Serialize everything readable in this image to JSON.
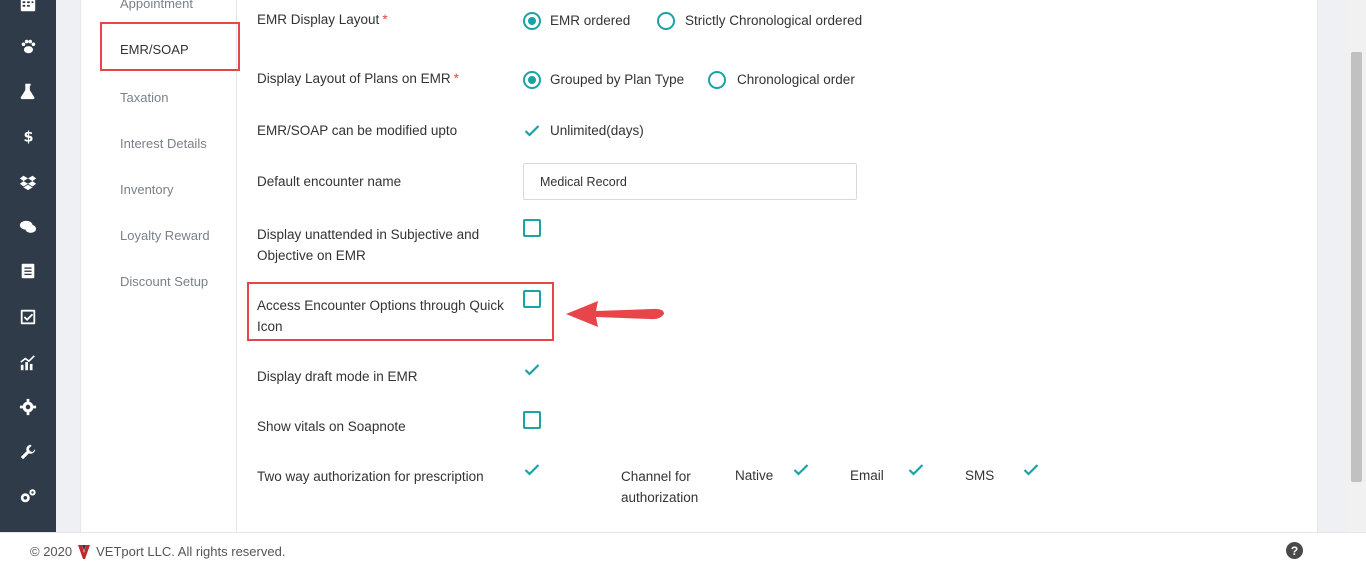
{
  "sidebar_icons": [
    "calendar-icon",
    "paw-icon",
    "flask-icon",
    "dollar-icon",
    "dropbox-icon",
    "chat-icon",
    "ledger-icon",
    "checklist-icon",
    "analytics-icon",
    "gear-icon",
    "wrench-icon",
    "cogs-icon"
  ],
  "subnav": {
    "items": [
      {
        "label": "Appointment"
      },
      {
        "label": "EMR/SOAP"
      },
      {
        "label": "Taxation"
      },
      {
        "label": "Interest Details"
      },
      {
        "label": "Inventory"
      },
      {
        "label": "Loyalty Reward"
      },
      {
        "label": "Discount Setup"
      }
    ],
    "active": "EMR/SOAP"
  },
  "settings": {
    "emr_display_layout": {
      "label": "EMR Display Layout",
      "required_mark": "*",
      "options": [
        {
          "label": "EMR ordered",
          "selected": true
        },
        {
          "label": "Strictly Chronological ordered",
          "selected": false
        }
      ]
    },
    "plans_layout": {
      "label": "Display Layout of Plans on EMR",
      "required_mark": "*",
      "options": [
        {
          "label": "Grouped by Plan Type",
          "selected": true
        },
        {
          "label": "Chronological order",
          "selected": false
        }
      ]
    },
    "modify_upto": {
      "label": "EMR/SOAP can be modified upto",
      "checked": true,
      "value_label": "Unlimited(days)"
    },
    "default_encounter": {
      "label": "Default encounter name",
      "value": "Medical Record"
    },
    "display_unattended": {
      "label_line1": "Display unattended in Subjective and",
      "label_line2": "Objective on EMR",
      "checked": false
    },
    "access_encounter": {
      "label_line1": "Access Encounter Options through Quick",
      "label_line2": "Icon",
      "checked": false
    },
    "draft_mode": {
      "label": "Display draft mode in EMR",
      "checked": true
    },
    "show_vitals": {
      "label": "Show vitals on Soapnote",
      "checked": false
    },
    "two_way_auth": {
      "label": "Two way authorization for prescription",
      "checked": true,
      "channel_label_line1": "Channel for",
      "channel_label_line2": "authorization",
      "channels": [
        {
          "label": "Native",
          "checked": true
        },
        {
          "label": "Email",
          "checked": true
        },
        {
          "label": "SMS",
          "checked": true
        }
      ]
    }
  },
  "footer": {
    "copyright": "© 2020",
    "company": "VETport LLC. All rights reserved.",
    "help_glyph": "?"
  },
  "colors": {
    "rail_bg": "#2f3b48",
    "accent_teal": "#1aa3a6",
    "highlight_red": "#e8454a"
  }
}
